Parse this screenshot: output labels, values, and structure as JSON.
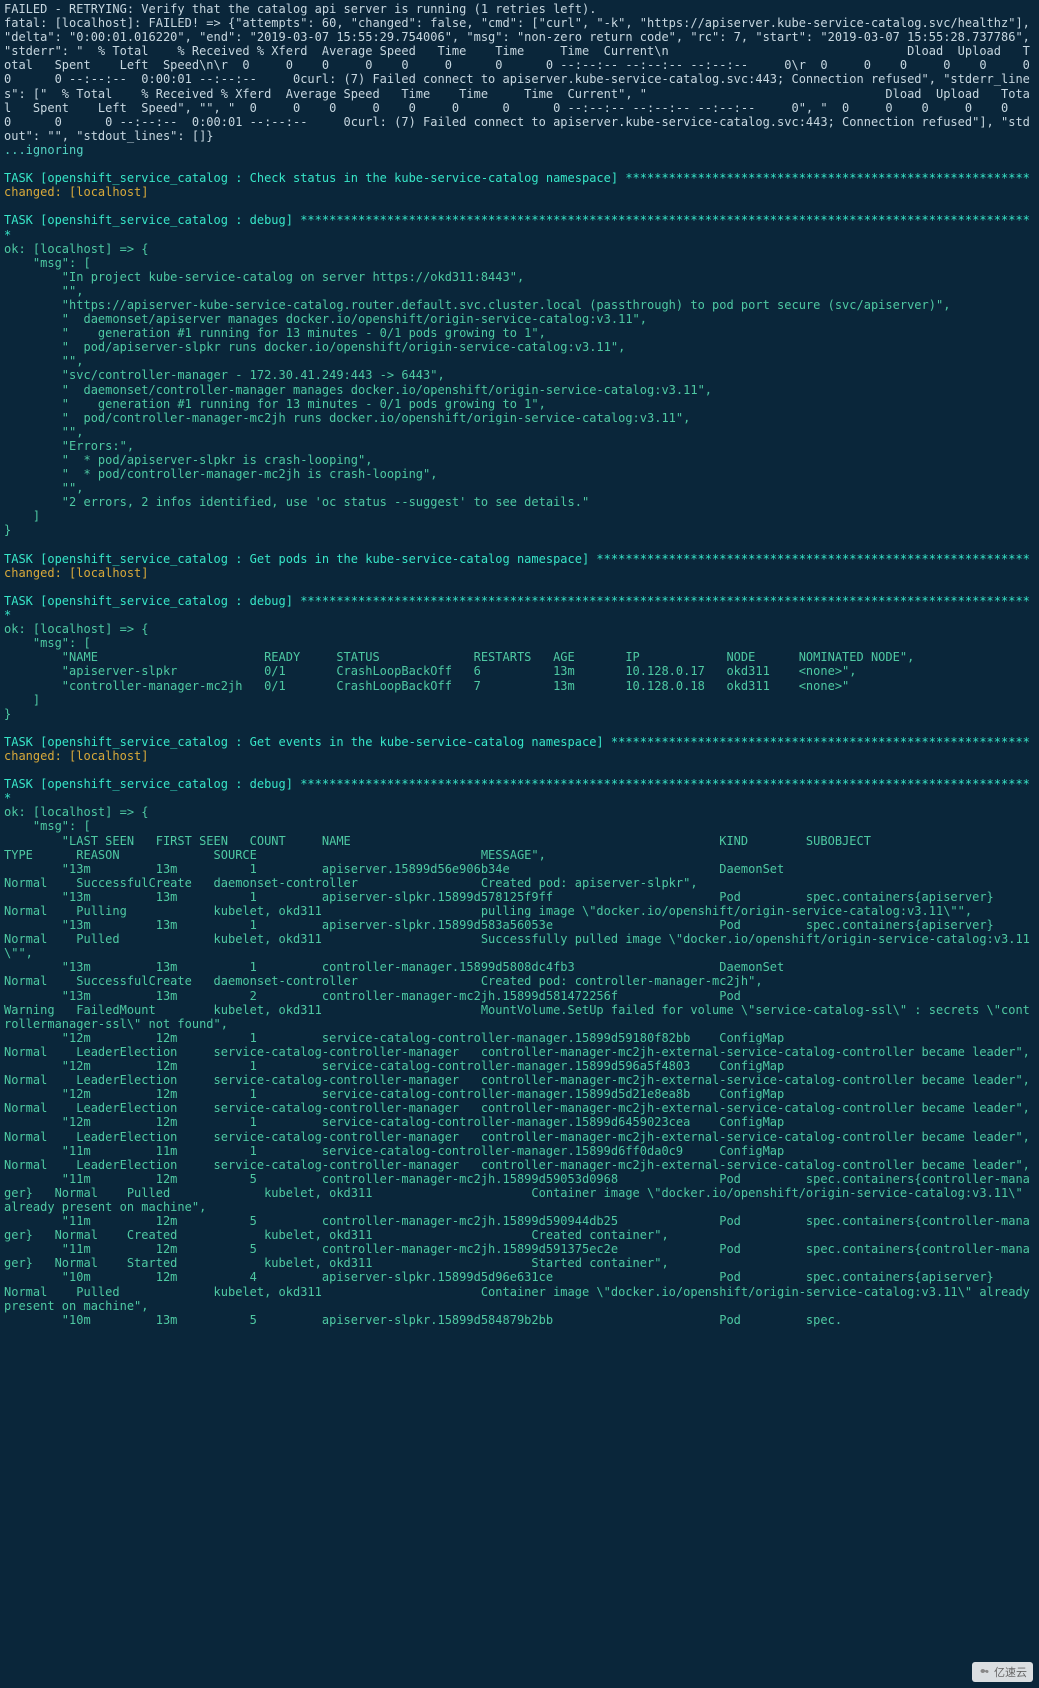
{
  "lines": [
    {
      "cls": "",
      "text": "FAILED - RETRYING: Verify that the catalog api server is running (1 retries left)."
    },
    {
      "cls": "",
      "text": "fatal: [localhost]: FAILED! => {\"attempts\": 60, \"changed\": false, \"cmd\": [\"curl\", \"-k\", \"https://apiserver.kube-service-catalog.svc/healthz\"], \"delta\": \"0:00:01.016220\", \"end\": \"2019-03-07 15:55:29.754006\", \"msg\": \"non-zero return code\", \"rc\": 7, \"start\": \"2019-03-07 15:55:28.737786\", \"stderr\": \"  % Total    % Received % Xferd  Average Speed   Time    Time     Time  Current\\n                                 Dload  Upload   Total   Spent    Left  Speed\\n\\r  0     0    0     0    0     0      0      0 --:--:-- --:--:-- --:--:--     0\\r  0     0    0     0    0     0      0      0 --:--:--  0:00:01 --:--:--     0curl: (7) Failed connect to apiserver.kube-service-catalog.svc:443; Connection refused\", \"stderr_lines\": [\"  % Total    % Received % Xferd  Average Speed   Time    Time     Time  Current\", \"                                 Dload  Upload   Total   Spent    Left  Speed\", \"\", \"  0     0    0     0    0     0      0      0 --:--:-- --:--:-- --:--:--     0\", \"  0     0    0     0    0     0      0      0 --:--:--  0:00:01 --:--:--     0curl: (7) Failed connect to apiserver.kube-service-catalog.svc:443; Connection refused\"], \"stdout\": \"\", \"stdout_lines\": []}"
    },
    {
      "cls": "cyan",
      "text": "...ignoring"
    },
    {
      "cls": "",
      "text": ""
    },
    {
      "cls": "tealbright",
      "text": "TASK [openshift_service_catalog : Check status in the kube-service-catalog namespace] ********************************************************"
    },
    {
      "cls": "gold",
      "text": "changed: [localhost]"
    },
    {
      "cls": "",
      "text": ""
    },
    {
      "cls": "tealbright",
      "text": "TASK [openshift_service_catalog : debug] ******************************************************************************************************"
    },
    {
      "cls": "conn",
      "text": "ok: [localhost] => {"
    },
    {
      "cls": "conn",
      "text": "    \"msg\": ["
    },
    {
      "cls": "conn",
      "text": "        \"In project kube-service-catalog on server https://okd311:8443\","
    },
    {
      "cls": "conn",
      "text": "        \"\","
    },
    {
      "cls": "conn",
      "text": "        \"https://apiserver-kube-service-catalog.router.default.svc.cluster.local (passthrough) to pod port secure (svc/apiserver)\","
    },
    {
      "cls": "conn",
      "text": "        \"  daemonset/apiserver manages docker.io/openshift/origin-service-catalog:v3.11\","
    },
    {
      "cls": "conn",
      "text": "        \"    generation #1 running for 13 minutes - 0/1 pods growing to 1\","
    },
    {
      "cls": "conn",
      "text": "        \"  pod/apiserver-slpkr runs docker.io/openshift/origin-service-catalog:v3.11\","
    },
    {
      "cls": "conn",
      "text": "        \"\","
    },
    {
      "cls": "conn",
      "text": "        \"svc/controller-manager - 172.30.41.249:443 -> 6443\","
    },
    {
      "cls": "conn",
      "text": "        \"  daemonset/controller-manager manages docker.io/openshift/origin-service-catalog:v3.11\","
    },
    {
      "cls": "conn",
      "text": "        \"    generation #1 running for 13 minutes - 0/1 pods growing to 1\","
    },
    {
      "cls": "conn",
      "text": "        \"  pod/controller-manager-mc2jh runs docker.io/openshift/origin-service-catalog:v3.11\","
    },
    {
      "cls": "conn",
      "text": "        \"\","
    },
    {
      "cls": "conn",
      "text": "        \"Errors:\","
    },
    {
      "cls": "conn",
      "text": "        \"  * pod/apiserver-slpkr is crash-looping\","
    },
    {
      "cls": "conn",
      "text": "        \"  * pod/controller-manager-mc2jh is crash-looping\","
    },
    {
      "cls": "conn",
      "text": "        \"\","
    },
    {
      "cls": "conn",
      "text": "        \"2 errors, 2 infos identified, use 'oc status --suggest' to see details.\""
    },
    {
      "cls": "conn",
      "text": "    ]"
    },
    {
      "cls": "conn",
      "text": "}"
    },
    {
      "cls": "",
      "text": ""
    },
    {
      "cls": "tealbright",
      "text": "TASK [openshift_service_catalog : Get pods in the kube-service-catalog namespace] ************************************************************"
    },
    {
      "cls": "gold",
      "text": "changed: [localhost]"
    },
    {
      "cls": "",
      "text": ""
    },
    {
      "cls": "tealbright",
      "text": "TASK [openshift_service_catalog : debug] ******************************************************************************************************"
    },
    {
      "cls": "conn",
      "text": "ok: [localhost] => {"
    },
    {
      "cls": "conn",
      "text": "    \"msg\": ["
    },
    {
      "cls": "conn",
      "text": "        \"NAME                       READY     STATUS             RESTARTS   AGE       IP            NODE      NOMINATED NODE\","
    },
    {
      "cls": "conn",
      "text": "        \"apiserver-slpkr            0/1       CrashLoopBackOff   6          13m       10.128.0.17   okd311    <none>\","
    },
    {
      "cls": "conn",
      "text": "        \"controller-manager-mc2jh   0/1       CrashLoopBackOff   7          13m       10.128.0.18   okd311    <none>\""
    },
    {
      "cls": "conn",
      "text": "    ]"
    },
    {
      "cls": "conn",
      "text": "}"
    },
    {
      "cls": "",
      "text": ""
    },
    {
      "cls": "tealbright",
      "text": "TASK [openshift_service_catalog : Get events in the kube-service-catalog namespace] **********************************************************"
    },
    {
      "cls": "gold",
      "text": "changed: [localhost]"
    },
    {
      "cls": "",
      "text": ""
    },
    {
      "cls": "tealbright",
      "text": "TASK [openshift_service_catalog : debug] ******************************************************************************************************"
    },
    {
      "cls": "conn",
      "text": "ok: [localhost] => {"
    },
    {
      "cls": "conn",
      "text": "    \"msg\": ["
    },
    {
      "cls": "conn",
      "text": "        \"LAST SEEN   FIRST SEEN   COUNT     NAME                                                   KIND        SUBOBJECT                           TYPE      REASON             SOURCE                               MESSAGE\","
    },
    {
      "cls": "conn",
      "text": "        \"13m         13m          1         apiserver.15899d56e906b34e                             DaemonSet                                       Normal    SuccessfulCreate   daemonset-controller                 Created pod: apiserver-slpkr\","
    },
    {
      "cls": "conn",
      "text": "        \"13m         13m          1         apiserver-slpkr.15899d578125f9ff                       Pod         spec.containers{apiserver}            Normal    Pulling            kubelet, okd311                      pulling image \\\"docker.io/openshift/origin-service-catalog:v3.11\\\"\","
    },
    {
      "cls": "conn",
      "text": "        \"13m         13m          1         apiserver-slpkr.15899d583a56053e                       Pod         spec.containers{apiserver}            Normal    Pulled             kubelet, okd311                      Successfully pulled image \\\"docker.io/openshift/origin-service-catalog:v3.11\\\"\","
    },
    {
      "cls": "conn",
      "text": "        \"13m         13m          1         controller-manager.15899d5808dc4fb3                    DaemonSet                                       Normal    SuccessfulCreate   daemonset-controller                 Created pod: controller-manager-mc2jh\","
    },
    {
      "cls": "conn",
      "text": "        \"13m         13m          2         controller-manager-mc2jh.15899d581472256f              Pod                                             Warning   FailedMount        kubelet, okd311                      MountVolume.SetUp failed for volume \\\"service-catalog-ssl\\\" : secrets \\\"controllermanager-ssl\\\" not found\","
    },
    {
      "cls": "conn",
      "text": "        \"12m         12m          1         service-catalog-controller-manager.15899d59180f82bb    ConfigMap                                       Normal    LeaderElection     service-catalog-controller-manager   controller-manager-mc2jh-external-service-catalog-controller became leader\","
    },
    {
      "cls": "conn",
      "text": "        \"12m         12m          1         service-catalog-controller-manager.15899d596a5f4803    ConfigMap                                       Normal    LeaderElection     service-catalog-controller-manager   controller-manager-mc2jh-external-service-catalog-controller became leader\","
    },
    {
      "cls": "conn",
      "text": "        \"12m         12m          1         service-catalog-controller-manager.15899d5d21e8ea8b    ConfigMap                                       Normal    LeaderElection     service-catalog-controller-manager   controller-manager-mc2jh-external-service-catalog-controller became leader\","
    },
    {
      "cls": "conn",
      "text": "        \"12m         12m          1         service-catalog-controller-manager.15899d6459023cea    ConfigMap                                       Normal    LeaderElection     service-catalog-controller-manager   controller-manager-mc2jh-external-service-catalog-controller became leader\","
    },
    {
      "cls": "conn",
      "text": "        \"11m         11m          1         service-catalog-controller-manager.15899d6ff0da0c9     ConfigMap                                       Normal    LeaderElection     service-catalog-controller-manager   controller-manager-mc2jh-external-service-catalog-controller became leader\","
    },
    {
      "cls": "conn",
      "text": "        \"11m         12m          5         controller-manager-mc2jh.15899d59053d0968              Pod         spec.containers{controller-manager}   Normal    Pulled             kubelet, okd311                      Container image \\\"docker.io/openshift/origin-service-catalog:v3.11\\\" already present on machine\","
    },
    {
      "cls": "conn",
      "text": "        \"11m         12m          5         controller-manager-mc2jh.15899d590944db25              Pod         spec.containers{controller-manager}   Normal    Created            kubelet, okd311                      Created container\","
    },
    {
      "cls": "conn",
      "text": "        \"11m         12m          5         controller-manager-mc2jh.15899d591375ec2e              Pod         spec.containers{controller-manager}   Normal    Started            kubelet, okd311                      Started container\","
    },
    {
      "cls": "conn",
      "text": "        \"10m         12m          4         apiserver-slpkr.15899d5d96e631ce                       Pod         spec.containers{apiserver}            Normal    Pulled             kubelet, okd311                      Container image \\\"docker.io/openshift/origin-service-catalog:v3.11\\\" already present on machine\","
    },
    {
      "cls": "conn",
      "text": "        \"10m         13m          5         apiserver-slpkr.15899d584879b2bb                       Pod         spec."
    }
  ],
  "watermark": "亿速云"
}
